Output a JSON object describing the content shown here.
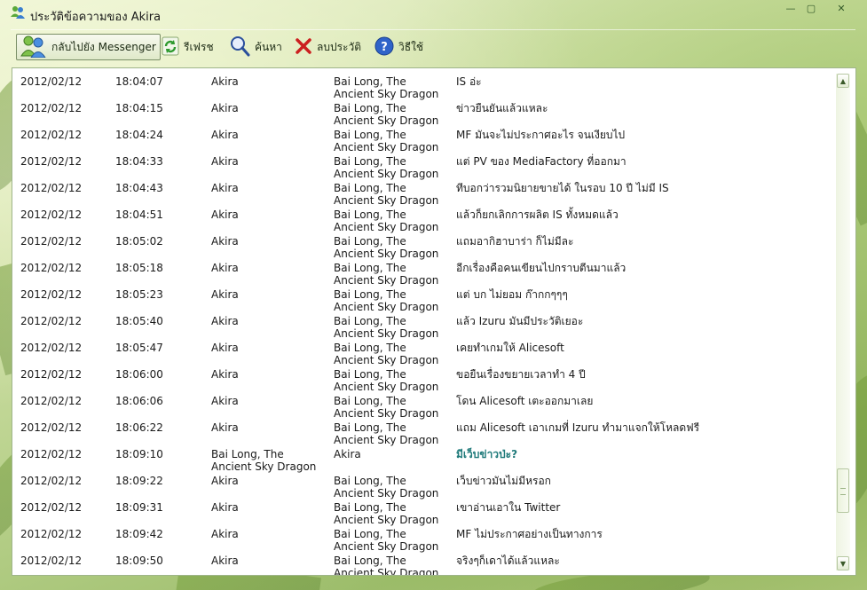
{
  "window": {
    "title": "ประวัติข้อความของ Akira",
    "controls": {
      "minimize": "—",
      "maximize": "▢",
      "close": "✕"
    }
  },
  "toolbar": {
    "back_label": "กลับไปยัง Messenger",
    "refresh_label": "รีเฟรช",
    "search_label": "ค้นหา",
    "delete_label": "ลบประวัติ",
    "help_label": "วิธีใช้"
  },
  "messages": [
    {
      "date": "2012/02/12",
      "time": "18:04:07",
      "from": "Akira",
      "to": "Bai Long, The Ancient Sky Dragon",
      "text": "IS อ่ะ",
      "highlight": false
    },
    {
      "date": "2012/02/12",
      "time": "18:04:15",
      "from": "Akira",
      "to": "Bai Long, The Ancient Sky Dragon",
      "text": "ข่าวยืนยันแล้วแหละ",
      "highlight": false
    },
    {
      "date": "2012/02/12",
      "time": "18:04:24",
      "from": "Akira",
      "to": "Bai Long, The Ancient Sky Dragon",
      "text": "MF มันจะไม่ประกาศอะไร จนเงียบไป",
      "highlight": false
    },
    {
      "date": "2012/02/12",
      "time": "18:04:33",
      "from": "Akira",
      "to": "Bai Long, The Ancient Sky Dragon",
      "text": "แต่ PV ของ MediaFactory ที่ออกมา",
      "highlight": false
    },
    {
      "date": "2012/02/12",
      "time": "18:04:43",
      "from": "Akira",
      "to": "Bai Long, The Ancient Sky Dragon",
      "text": "ทีบอกว่ารวมนิยายขายได้ ในรอบ 10 ปี ไม่มี IS",
      "highlight": false
    },
    {
      "date": "2012/02/12",
      "time": "18:04:51",
      "from": "Akira",
      "to": "Bai Long, The Ancient Sky Dragon",
      "text": "แล้วก็ยกเลิกการผลิต IS ทั้งหมดแล้ว",
      "highlight": false
    },
    {
      "date": "2012/02/12",
      "time": "18:05:02",
      "from": "Akira",
      "to": "Bai Long, The Ancient Sky Dragon",
      "text": "แถมอากิฮาบาร่า ก็ไม่มีละ",
      "highlight": false
    },
    {
      "date": "2012/02/12",
      "time": "18:05:18",
      "from": "Akira",
      "to": "Bai Long, The Ancient Sky Dragon",
      "text": "อีกเรื่องคือคนเขียนไปกราบตีนมาแล้ว",
      "highlight": false
    },
    {
      "date": "2012/02/12",
      "time": "18:05:23",
      "from": "Akira",
      "to": "Bai Long, The Ancient Sky Dragon",
      "text": "แต่ บก ไม่ยอม ก๊ากกๆๆๆ",
      "highlight": false
    },
    {
      "date": "2012/02/12",
      "time": "18:05:40",
      "from": "Akira",
      "to": "Bai Long, The Ancient Sky Dragon",
      "text": "แล้ว Izuru มันมีประวัติเยอะ",
      "highlight": false
    },
    {
      "date": "2012/02/12",
      "time": "18:05:47",
      "from": "Akira",
      "to": "Bai Long, The Ancient Sky Dragon",
      "text": "เคยทำเกมให้ Alicesoft",
      "highlight": false
    },
    {
      "date": "2012/02/12",
      "time": "18:06:00",
      "from": "Akira",
      "to": "Bai Long, The Ancient Sky Dragon",
      "text": "ขอยืนเรื่องขยายเวลาทำ 4 ปี",
      "highlight": false
    },
    {
      "date": "2012/02/12",
      "time": "18:06:06",
      "from": "Akira",
      "to": "Bai Long, The Ancient Sky Dragon",
      "text": "โดน Alicesoft เตะออกมาเลย",
      "highlight": false
    },
    {
      "date": "2012/02/12",
      "time": "18:06:22",
      "from": "Akira",
      "to": "Bai Long, The Ancient Sky Dragon",
      "text": "แถม Alicesoft เอาเกมที่ Izuru ทำมาแจกให้โหลดฟรี",
      "highlight": false
    },
    {
      "date": "2012/02/12",
      "time": "18:09:10",
      "from": "Bai Long, The Ancient Sky Dragon",
      "to": "Akira",
      "text": "มีเว็บข่าวป่ะ?",
      "highlight": true
    },
    {
      "date": "2012/02/12",
      "time": "18:09:22",
      "from": "Akira",
      "to": "Bai Long, The Ancient Sky Dragon",
      "text": "เว็บข่าวมันไม่มีหรอก",
      "highlight": false
    },
    {
      "date": "2012/02/12",
      "time": "18:09:31",
      "from": "Akira",
      "to": "Bai Long, The Ancient Sky Dragon",
      "text": "เขาอ่านเอาใน Twitter",
      "highlight": false
    },
    {
      "date": "2012/02/12",
      "time": "18:09:42",
      "from": "Akira",
      "to": "Bai Long, The Ancient Sky Dragon",
      "text": "MF ไม่ประกาศอย่างเป็นทางการ",
      "highlight": false
    },
    {
      "date": "2012/02/12",
      "time": "18:09:50",
      "from": "Akira",
      "to": "Bai Long, The Ancient Sky Dragon",
      "text": "จริงๆก็เดาได้แล้วแหละ",
      "highlight": false
    }
  ],
  "scrollbar": {
    "up_arrow": "▲",
    "down_arrow": "▼",
    "position": 0.9
  },
  "colors": {
    "highlight_text": "#1f7a7a",
    "background_green": "#b7d08a"
  }
}
